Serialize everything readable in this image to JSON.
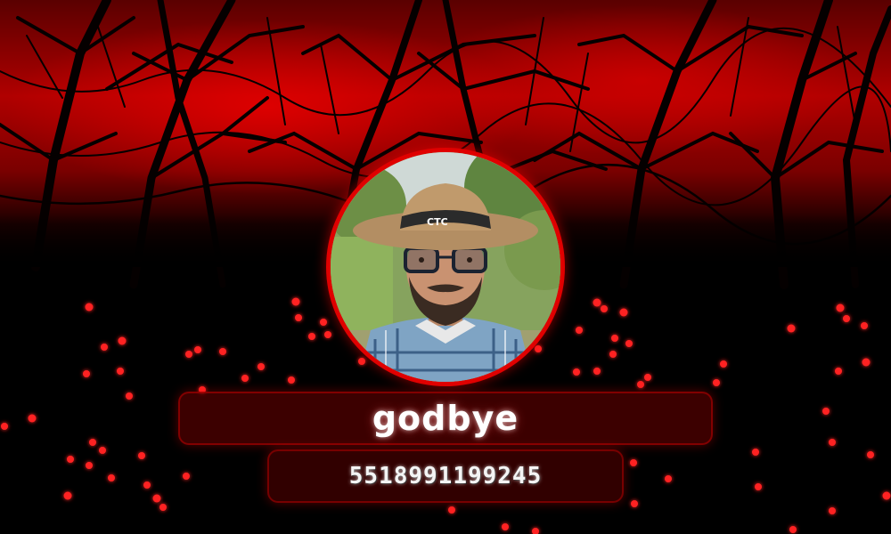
{
  "profile": {
    "name": "godbye",
    "phone": "5518991199245",
    "avatar_hat_text": "CTC"
  },
  "theme": {
    "accent": "#e00000",
    "particle": "#ff2020",
    "background": "#000000",
    "text": "#ffffff"
  },
  "icons": {
    "avatar": "profile-photo"
  }
}
